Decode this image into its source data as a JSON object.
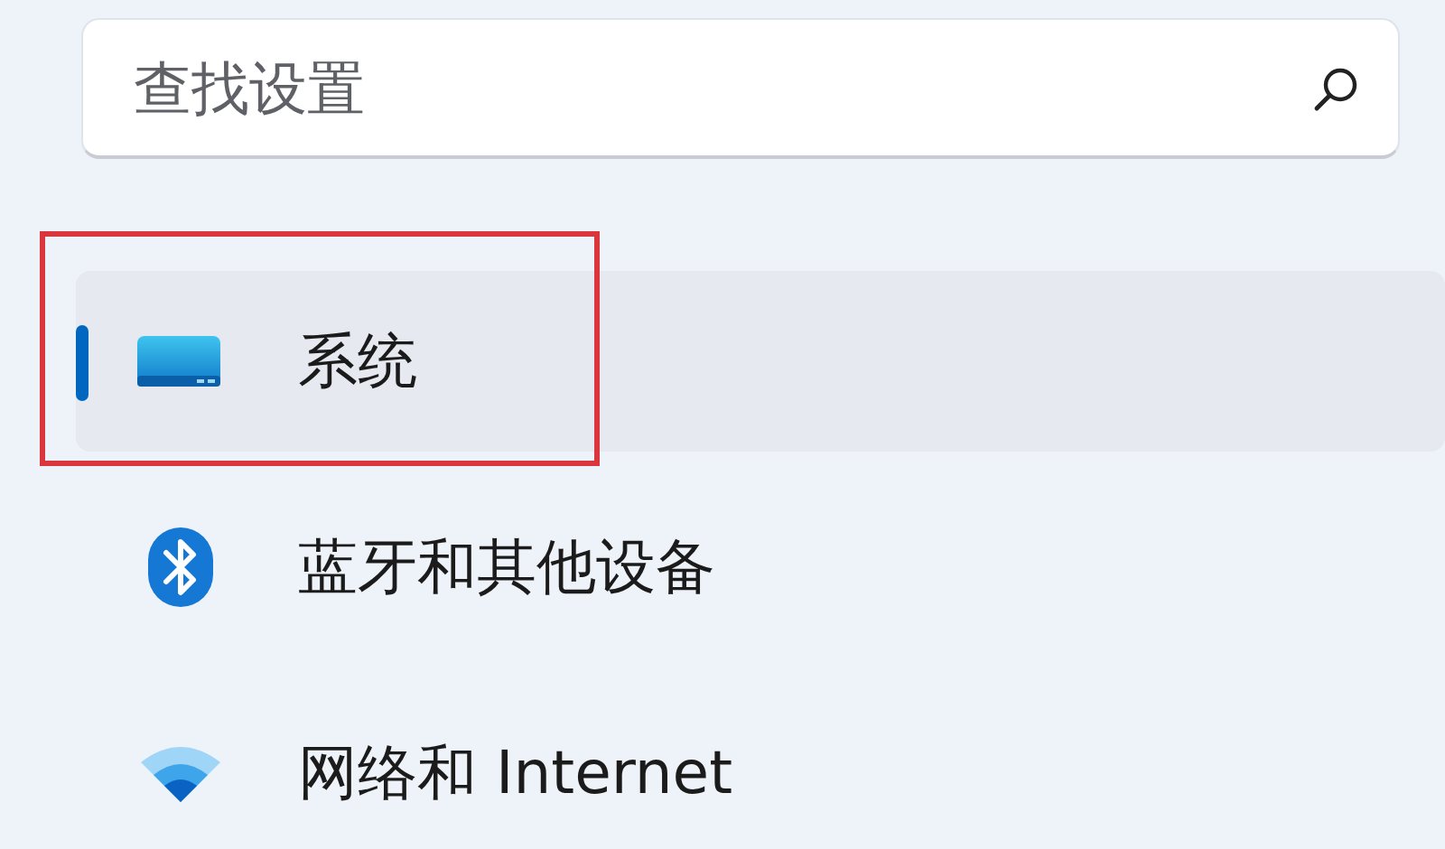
{
  "search": {
    "placeholder": "查找设置"
  },
  "nav_items": [
    {
      "label": "系统",
      "kind": "system",
      "selected": true,
      "highlighted": true
    },
    {
      "label": "蓝牙和其他设备",
      "kind": "bluetooth",
      "selected": false,
      "highlighted": false
    },
    {
      "label": "网络和 Internet",
      "kind": "network",
      "selected": false,
      "highlighted": false
    }
  ]
}
